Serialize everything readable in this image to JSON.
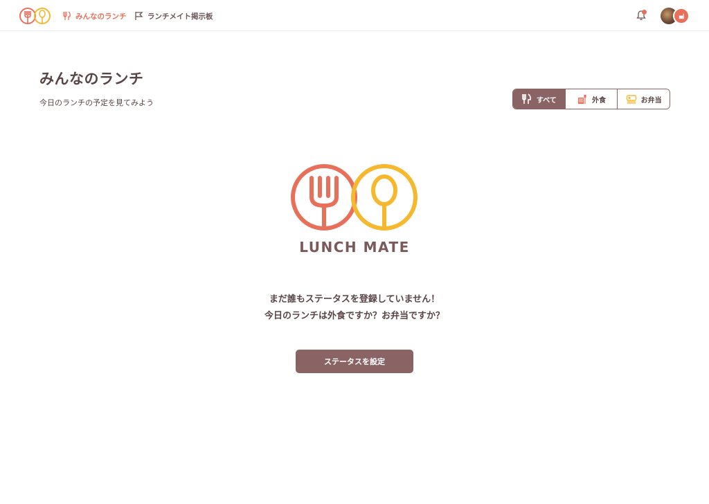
{
  "header": {
    "nav": [
      {
        "label": "みんなのランチ",
        "icon": "fork-knife-icon",
        "color": "#e8705b"
      },
      {
        "label": "ランチメイト掲示板",
        "icon": "flag-icon"
      }
    ],
    "notification_icon": "bell-icon"
  },
  "page": {
    "title": "みんなのランチ",
    "subtitle": "今日のランチの予定を見てみよう"
  },
  "filters": [
    {
      "label": "すべて",
      "icon": "utensils-icon",
      "active": true
    },
    {
      "label": "外食",
      "icon": "restaurant-icon",
      "active": false
    },
    {
      "label": "お弁当",
      "icon": "bento-icon",
      "active": false
    }
  ],
  "brand": {
    "name": "LUNCH MATE",
    "colors": {
      "primary": "#e8705b",
      "secondary": "#f5b82e",
      "accent": "#8a6465"
    }
  },
  "empty_state": {
    "line1": "まだ誰もステータスを登録していません！",
    "line2": "今日のランチは外食ですか？お弁当ですか？",
    "button": "ステータスを設定"
  }
}
